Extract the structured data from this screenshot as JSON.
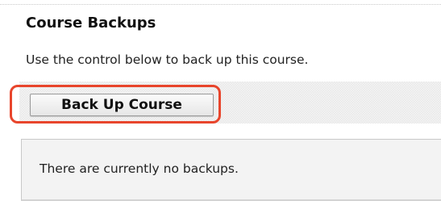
{
  "section": {
    "title": "Course Backups",
    "description": "Use the control below to back up this course."
  },
  "controls": {
    "backup_button_label": "Back Up Course",
    "highlight_color": "#e8452c"
  },
  "status": {
    "message": "There are currently no backups."
  }
}
